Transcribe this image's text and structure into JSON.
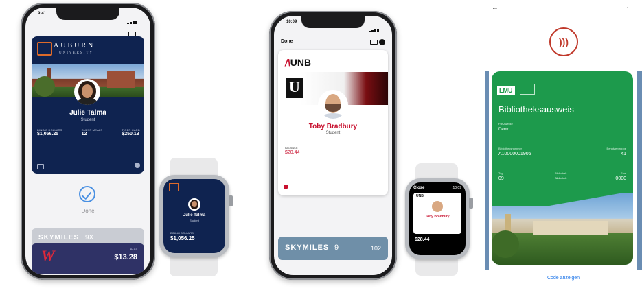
{
  "phone1": {
    "time": "9:41",
    "card": {
      "school_name": "AUBURN",
      "school_sub": "UNIVERSITY",
      "holder_name": "Julie Talma",
      "holder_role": "Student",
      "fields": [
        {
          "label": "DINING DOLLARS",
          "value": "$1,056.25"
        },
        {
          "label": "GUEST MEALS",
          "value": "12"
        },
        {
          "label": "TIGER CARD",
          "value": "$250.13"
        }
      ]
    },
    "done_label": "Done",
    "bottom_cards": [
      {
        "label": "SKYMILES",
        "value": "9X",
        "color": "#c9ccd3"
      },
      {
        "label": "PASS",
        "value": "$13.28",
        "color": "#2f3266"
      }
    ]
  },
  "watch1": {
    "holder_name": "Julie Talma",
    "holder_role": "Student",
    "balance_label": "DINING DOLLARS",
    "balance": "$1,056.25"
  },
  "phone2": {
    "time": "10:09",
    "done_label": "Done",
    "card": {
      "logo": "UNB",
      "holder_name": "Toby Bradbury",
      "holder_role": "Student",
      "balance_label": "BALANCE",
      "balance": "$20.44"
    },
    "bottom_card": {
      "label": "SKYMILES",
      "value": "9",
      "num": "102"
    }
  },
  "watch2": {
    "close_label": "Close",
    "time": "10:09",
    "logo": "UNB",
    "holder_name": "Toby Bradbury",
    "balance": "$28.44"
  },
  "android": {
    "card": {
      "logo": "LMU",
      "title": "Bibliotheksausweis",
      "subtitle_label": "Für Zwecke",
      "subtitle_value": "Demo",
      "fields": [
        {
          "label": "Bibliotheksnummer",
          "value": "A10000001906"
        },
        {
          "label": "Benutzergruppe",
          "value": "41"
        },
        {
          "label": "Tag",
          "value": "09"
        },
        {
          "label": "Bibliothek",
          "value": "Bibliothek"
        },
        {
          "label": "Saal",
          "value": "0000"
        }
      ]
    },
    "code_button": "Code anzeigen",
    "card_color": "#1d9a4c"
  }
}
